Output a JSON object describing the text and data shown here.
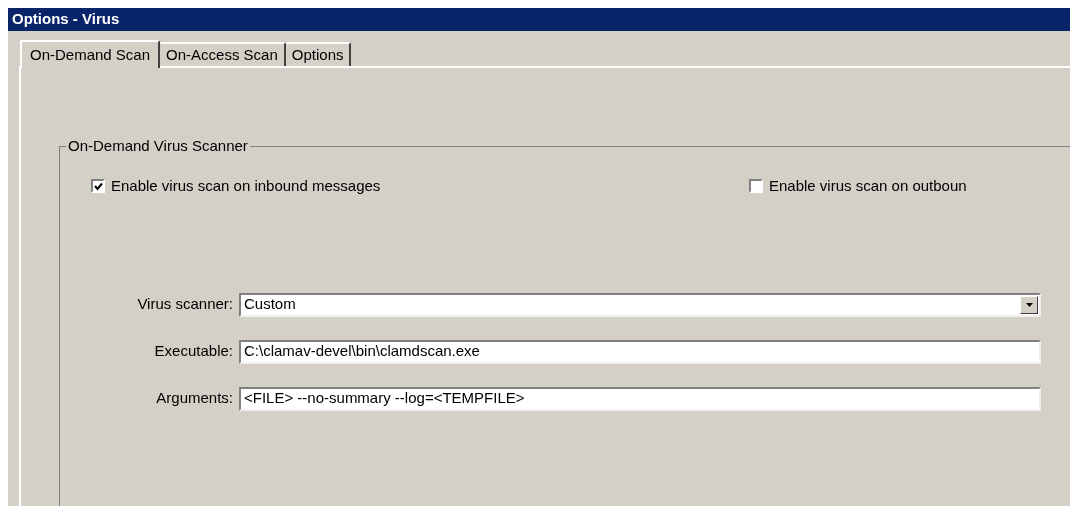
{
  "window": {
    "title": "Options - Virus"
  },
  "tabs": [
    {
      "label": "On-Demand Scan",
      "selected": true
    },
    {
      "label": "On-Access Scan",
      "selected": false
    },
    {
      "label": "Options",
      "selected": false
    }
  ],
  "group": {
    "title": "On-Demand Virus Scanner"
  },
  "checkboxes": [
    {
      "label": "Enable virus scan on inbound messages",
      "checked": true
    },
    {
      "label": "Enable virus scan on outboun",
      "checked": false
    }
  ],
  "fields": [
    {
      "kind": "dropdown",
      "label": "Virus scanner:",
      "value": "Custom"
    },
    {
      "kind": "text",
      "label": "Executable:",
      "value": "C:\\clamav-devel\\bin\\clamdscan.exe"
    },
    {
      "kind": "text",
      "label": "Arguments:",
      "value": "<FILE> --no-summary --log=<TEMPFILE>"
    }
  ]
}
